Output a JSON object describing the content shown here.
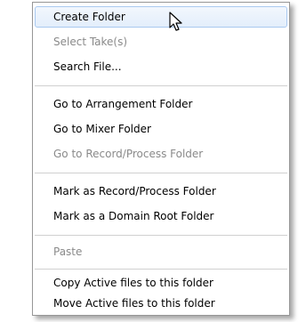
{
  "menu": {
    "items": [
      {
        "label": "Create Folder",
        "state": "highlighted"
      },
      {
        "label": "Select Take(s)",
        "state": "disabled"
      },
      {
        "label": "Search File...",
        "state": "enabled"
      },
      {
        "label": "Go to Arrangement Folder",
        "state": "enabled"
      },
      {
        "label": "Go to Mixer Folder",
        "state": "enabled"
      },
      {
        "label": "Go to Record/Process Folder",
        "state": "disabled"
      },
      {
        "label": "Mark as Record/Process Folder",
        "state": "enabled"
      },
      {
        "label": "Mark as a Domain Root Folder",
        "state": "enabled"
      },
      {
        "label": "Paste",
        "state": "disabled"
      },
      {
        "label": "Copy Active files to this folder",
        "state": "enabled"
      },
      {
        "label": "Move Active files to this folder",
        "state": "enabled"
      }
    ]
  },
  "cursor": {
    "icon": "mouse-pointer-icon"
  }
}
